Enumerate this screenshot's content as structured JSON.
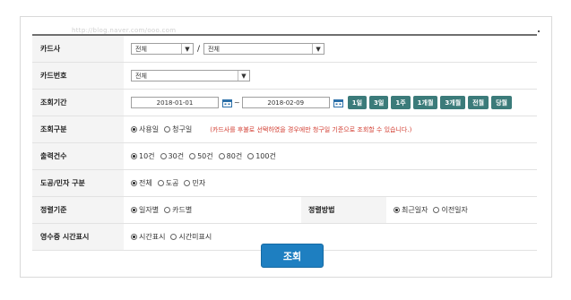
{
  "watermark": "http://blog.naver.com/ooo.com",
  "rows": {
    "card_company": {
      "label": "카드사",
      "select1": "전체",
      "select2": "전체"
    },
    "card_number": {
      "label": "카드번호",
      "select": "전체"
    },
    "period": {
      "label": "조회기간",
      "from": "2018-01-01",
      "to": "2018-02-09",
      "buttons": [
        "1일",
        "3일",
        "1주",
        "1개월",
        "3개월",
        "전월",
        "당월"
      ]
    },
    "query_type": {
      "label": "조회구분",
      "options": [
        "사용일",
        "청구일"
      ],
      "selected": 0,
      "note": "(카드사를 후불로 선택하였을 경우에만 청구일 기준으로 조회할 수 있습니다.)"
    },
    "output_count": {
      "label": "출력건수",
      "options": [
        "10건",
        "30건",
        "50건",
        "80건",
        "100건"
      ],
      "selected": 0
    },
    "domestic_foreign": {
      "label": "도공/민자 구분",
      "options": [
        "전체",
        "도공",
        "민자"
      ],
      "selected": 0
    },
    "sort_basis": {
      "label": "정렬기준",
      "options": [
        "일자별",
        "카드별"
      ],
      "selected": 0
    },
    "sort_method": {
      "label": "정렬방법",
      "options": [
        "최근일자",
        "이전일자"
      ],
      "selected": 0
    },
    "receipt_time": {
      "label": "영수증 시간표시",
      "options": [
        "시간표시",
        "시간미표시"
      ],
      "selected": 0
    }
  },
  "search_button": "조회",
  "colors": {
    "period_button": "#3b7b7a",
    "search_button": "#1e7fc1",
    "note": "#d23b2f"
  }
}
